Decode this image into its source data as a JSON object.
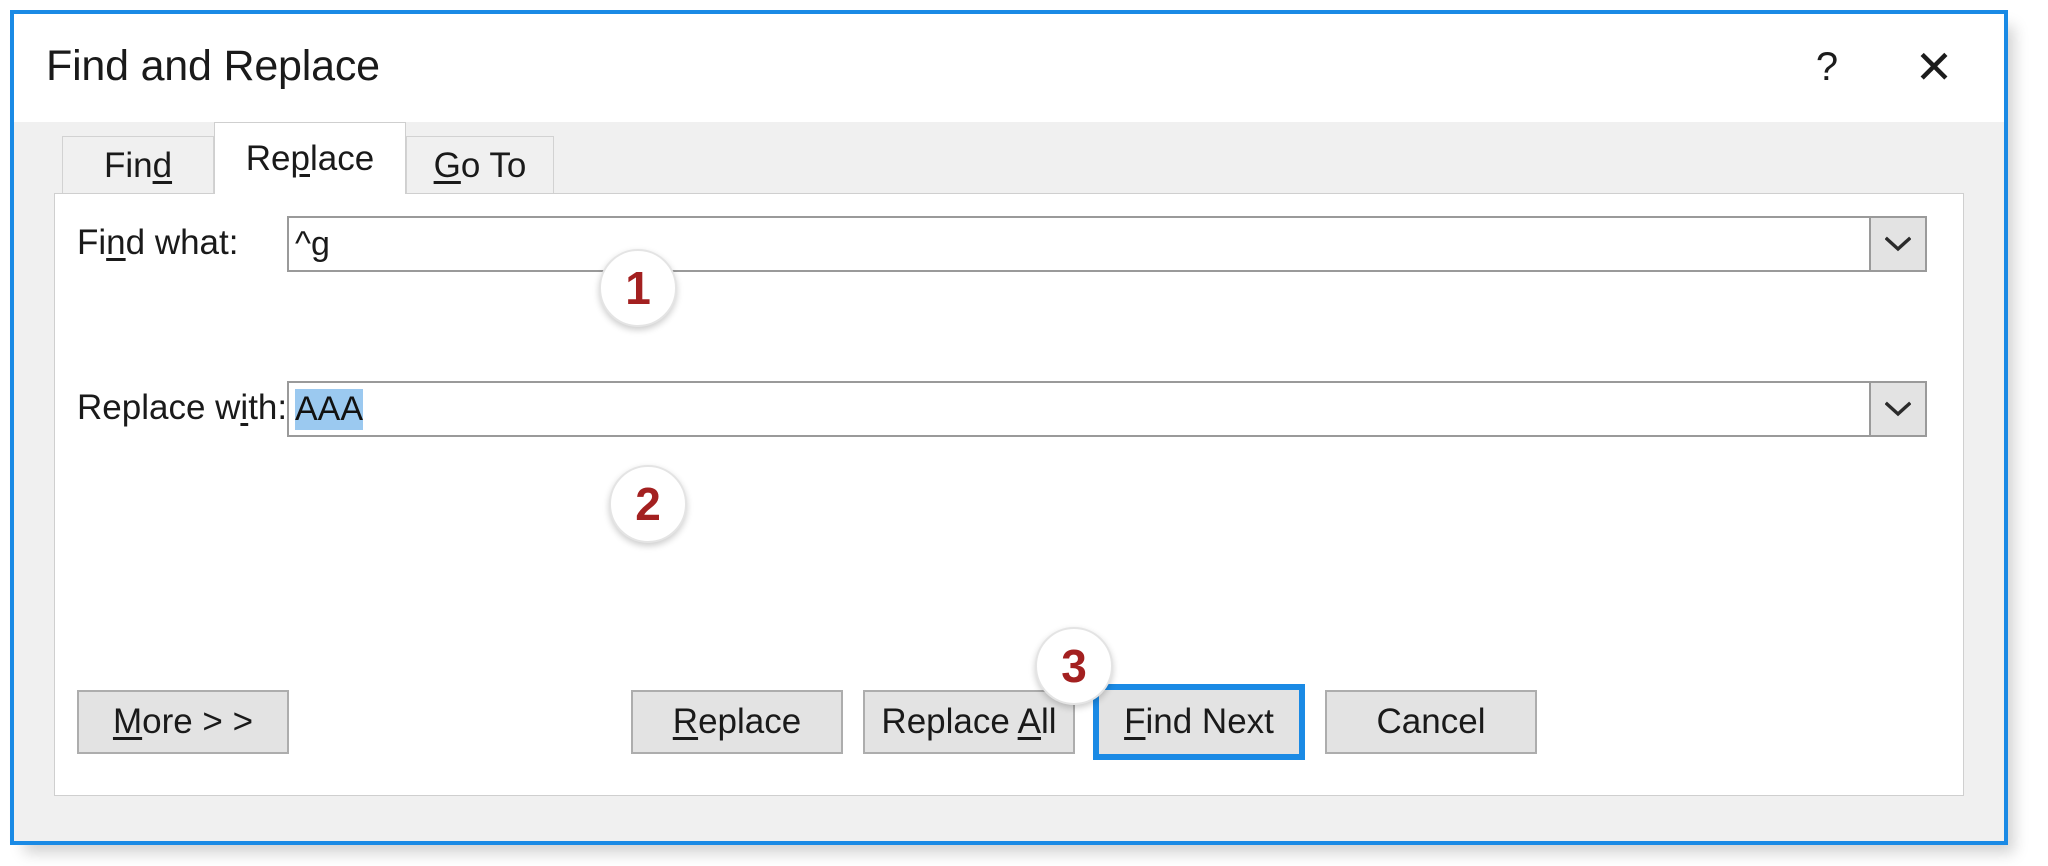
{
  "window": {
    "title": "Find and Replace",
    "help_glyph": "?",
    "close_glyph": "✕",
    "accent_color": "#1a8ae5"
  },
  "tabs": [
    {
      "label_pre": "Fin",
      "label_acc": "d",
      "label_post": "",
      "name": "find",
      "selected": false
    },
    {
      "label_pre": "Re",
      "label_acc": "p",
      "label_post": "lace",
      "name": "replace",
      "selected": true
    },
    {
      "label_pre": "",
      "label_acc": "G",
      "label_post": "o To",
      "name": "go-to",
      "selected": false
    }
  ],
  "fields": {
    "find": {
      "label_pre": "Fi",
      "label_acc": "n",
      "label_post": "d what:",
      "value": "^g",
      "selected": false
    },
    "replace": {
      "label_pre": "Replace w",
      "label_acc": "i",
      "label_post": "th:",
      "value": "AAA",
      "selected": true
    }
  },
  "buttons": {
    "more": {
      "pre": "",
      "acc": "M",
      "post": "ore > >"
    },
    "replace": {
      "pre": "",
      "acc": "R",
      "post": "eplace"
    },
    "replace_all": {
      "pre": "Replace ",
      "acc": "A",
      "post": "ll"
    },
    "find_next": {
      "pre": "",
      "acc": "F",
      "post": "ind Next"
    },
    "cancel": {
      "pre": "Cancel",
      "acc": "",
      "post": ""
    }
  },
  "annotations": [
    {
      "number": "1"
    },
    {
      "number": "2"
    },
    {
      "number": "3"
    }
  ]
}
